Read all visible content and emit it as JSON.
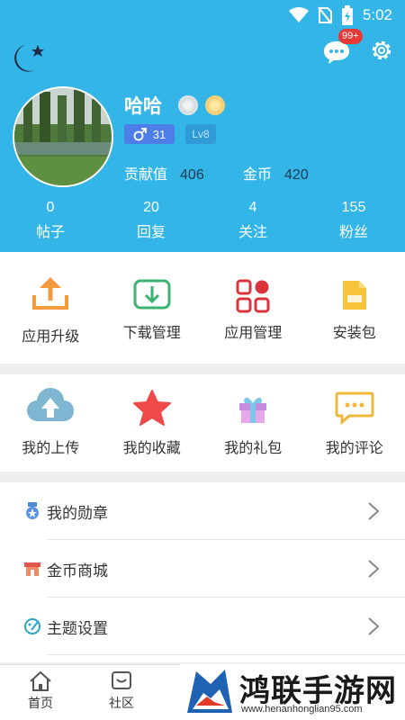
{
  "status_bar": {
    "time": "5:02"
  },
  "header": {
    "message_badge": "99+",
    "username": "哈哈",
    "gender_age": "31",
    "level": "Lv8",
    "contribution_label": "贡献值",
    "contribution_value": "406",
    "coins_label": "金币",
    "coins_value": "420",
    "counts": [
      {
        "value": "0",
        "label": "帖子"
      },
      {
        "value": "20",
        "label": "回复"
      },
      {
        "value": "4",
        "label": "关注"
      },
      {
        "value": "155",
        "label": "粉丝"
      }
    ]
  },
  "tools": [
    {
      "label": "应用升级",
      "icon": "upload-icon"
    },
    {
      "label": "下载管理",
      "icon": "download-icon"
    },
    {
      "label": "应用管理",
      "icon": "apps-icon"
    },
    {
      "label": "安装包",
      "icon": "apk-icon"
    }
  ],
  "personal": [
    {
      "label": "我的上传",
      "icon": "cloud-upload-icon"
    },
    {
      "label": "我的收藏",
      "icon": "star-icon"
    },
    {
      "label": "我的礼包",
      "icon": "gift-icon"
    },
    {
      "label": "我的评论",
      "icon": "comment-icon"
    }
  ],
  "menu": [
    {
      "label": "我的勋章",
      "icon": "medal-icon"
    },
    {
      "label": "金币商城",
      "icon": "shop-icon"
    },
    {
      "label": "主题设置",
      "icon": "palette-icon"
    }
  ],
  "bottom_nav": [
    {
      "label": "首页",
      "icon": "home-icon"
    },
    {
      "label": "社区",
      "icon": "community-icon"
    }
  ],
  "watermark": {
    "title": "鸿联手游网",
    "url": "www.henanhonglian95.com"
  },
  "colors": {
    "header_bg": "#33b5e8",
    "accent_orange": "#f29a3c",
    "accent_green": "#3cb371",
    "accent_red": "#d9343b"
  }
}
